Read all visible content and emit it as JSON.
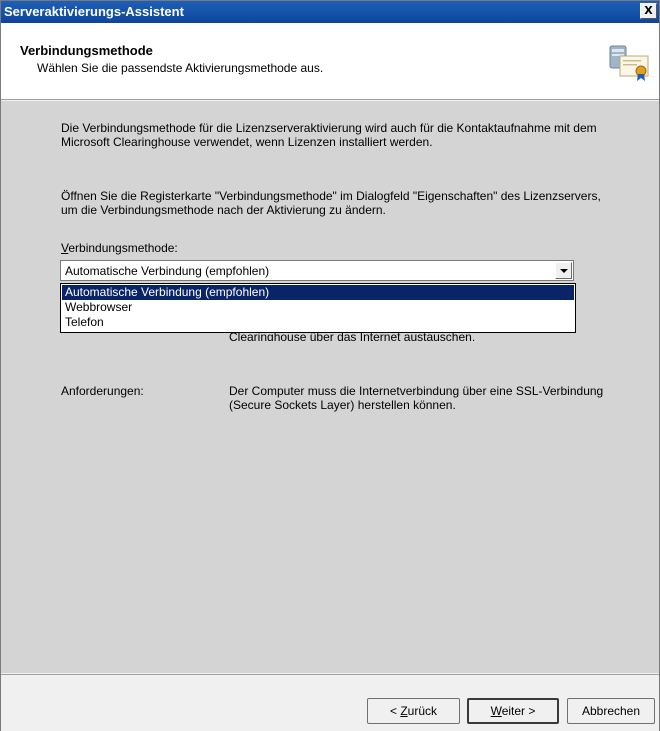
{
  "window": {
    "title": "Serveraktivierungs-Assistent",
    "close_glyph": "X"
  },
  "header": {
    "title": "Verbindungsmethode",
    "subtitle": "Wählen Sie die passendste Aktivierungsmethode aus.",
    "icon": "certificate-server-icon"
  },
  "content": {
    "paragraph1": "Die Verbindungsmethode für die Lizenzserveraktivierung wird auch für die Kontaktaufnahme mit dem Microsoft Clearinghouse verwendet, wenn Lizenzen installiert werden.",
    "paragraph2": "Öffnen Sie die Registerkarte \"Verbindungsmethode\" im Dialogfeld \"Eigenschaften\" des Lizenzservers, um die Verbindungsmethode nach der Aktivierung zu ändern.",
    "method_label_accel": "V",
    "method_label_rest": "erbindungsmethode:",
    "combo_value": "Automatische Verbindung (empfohlen)",
    "options": [
      "Automatische Verbindung (empfohlen)",
      "Webbrowser",
      "Telefon"
    ],
    "description_partial": "Clearinghouse über das Internet austauschen.",
    "requirements_label": "Anforderungen:",
    "requirements_text": "Der Computer muss die Internetverbindung über eine SSL-Verbindung (Secure Sockets Layer) herstellen können."
  },
  "buttons": {
    "back_prefix": "< ",
    "back_accel": "Z",
    "back_rest": "urück",
    "next_accel": "W",
    "next_rest": "eiter >",
    "cancel": "Abbrechen"
  },
  "colors": {
    "title_bar": "#1552a8",
    "selection": "#0a246a",
    "content_bg": "#d4d4d4"
  }
}
